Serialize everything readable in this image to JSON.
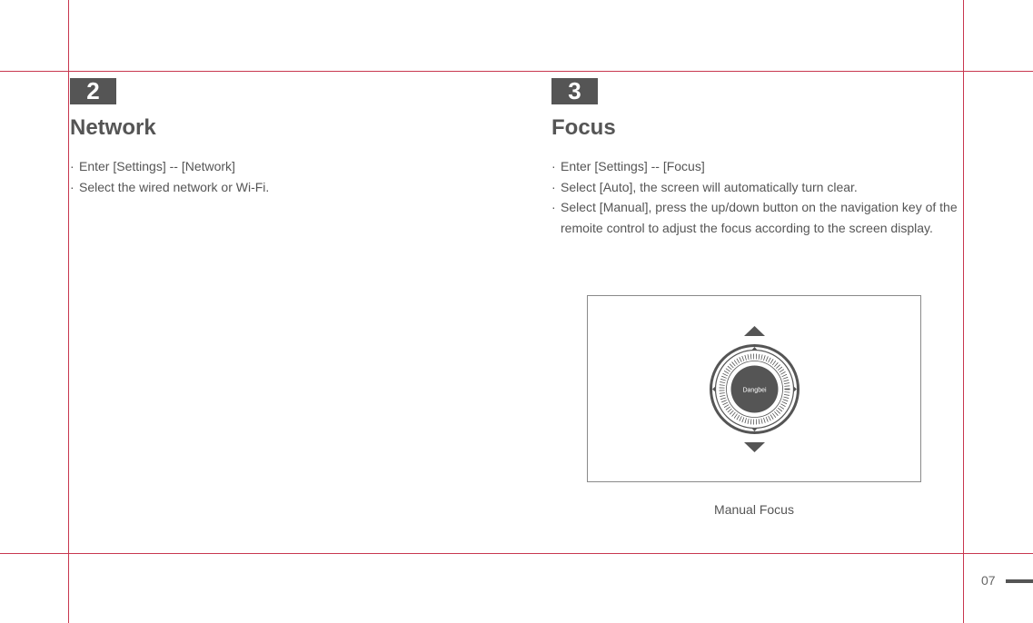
{
  "sections": [
    {
      "number": "2",
      "title": "Network",
      "bullets": [
        "Enter [Settings] -- [Network]",
        "Select the wired network or Wi-Fi."
      ]
    },
    {
      "number": "3",
      "title": "Focus",
      "bullets": [
        "Enter [Settings] -- [Focus]",
        "Select [Auto], the screen will automatically turn clear.",
        "Select [Manual], press the up/down button on the navigation key of the remoite control to adjust the focus according to the screen display."
      ]
    }
  ],
  "figure": {
    "remote_label": "Dangbei",
    "caption": "Manual Focus",
    "icons": [
      "arrow-up-icon",
      "arrow-down-icon",
      "focus-dial-icon"
    ]
  },
  "footer": {
    "page_number": "07"
  },
  "colors": {
    "guide_line": "#c8374f",
    "badge": "#555555",
    "text": "#555555"
  }
}
